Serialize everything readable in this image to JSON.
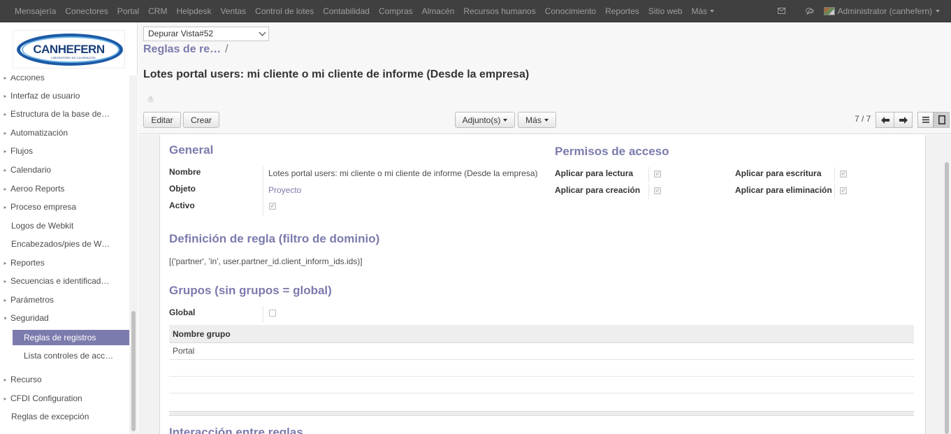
{
  "topbar": {
    "menu": [
      "Mensajería",
      "Conectores",
      "Portal",
      "CRM",
      "Helpdesk",
      "Ventas",
      "Control de lotes",
      "Contabilidad",
      "Compras",
      "Almacén",
      "Recursos humanos",
      "Conocimiento",
      "Reportes",
      "Sitio web",
      "Más"
    ],
    "user": "Administrator (canhefern)",
    "icons": [
      "mail-icon",
      "chat-icon"
    ]
  },
  "sidebar": {
    "logo_text": "CANHEFERN",
    "logo_sub": "LABORATORIO DE CALIBRACIÓN",
    "items": [
      {
        "label": "Acciones",
        "arrow": true
      },
      {
        "label": "Interfaz de usuario",
        "arrow": true
      },
      {
        "label": "Estructura de la base de…",
        "arrow": true
      },
      {
        "label": "Automatización",
        "arrow": true
      },
      {
        "label": "Flujos",
        "arrow": true
      },
      {
        "label": "Calendario",
        "arrow": true
      },
      {
        "label": "Aeroo Reports",
        "arrow": true
      },
      {
        "label": "Proceso empresa",
        "arrow": true
      },
      {
        "label": "Logos de Webkit",
        "arrow": false
      },
      {
        "label": "Encabezados/pies de W…",
        "arrow": false
      },
      {
        "label": "Reportes",
        "arrow": true
      },
      {
        "label": "Secuencias e identificad…",
        "arrow": true
      },
      {
        "label": "Parámetros",
        "arrow": true
      },
      {
        "label": "Seguridad",
        "arrow": true,
        "expanded": true
      },
      {
        "label": "Reglas de registros",
        "sub": true,
        "active": true
      },
      {
        "label": "Lista controles de acc…",
        "sub": true
      },
      {
        "label": "Recurso",
        "arrow": true
      },
      {
        "label": "CFDI Configuration",
        "arrow": true
      },
      {
        "label": "Reglas de excepción",
        "arrow": false
      }
    ]
  },
  "control_panel": {
    "debug_select": "Depurar Vista#52",
    "breadcrumb": "Reglas de re…",
    "breadcrumb_sep": "/",
    "record_title": "Lotes portal users: mi cliente o mi cliente de informe (Desde la empresa)",
    "edit": "Editar",
    "create": "Crear",
    "attachments": "Adjunto(s)",
    "more": "Más",
    "pager": "7 / 7"
  },
  "form": {
    "general_title": "General",
    "name_label": "Nombre",
    "name_value": "Lotes portal users: mi cliente o mi cliente de informe (Desde la empresa)",
    "object_label": "Objeto",
    "object_value": "Proyecto",
    "active_label": "Activo",
    "active": true,
    "access_title": "Permisos de acceso",
    "perm_read": "Aplicar para lectura",
    "perm_write": "Aplicar para escritura",
    "perm_create": "Aplicar para creación",
    "perm_delete": "Aplicar para eliminación",
    "rule_title": "Definición de regla (filtro de dominio)",
    "domain": "[('partner', 'in', user.partner_id.client_inform_ids.ids)]",
    "groups_title": "Grupos (sin grupos = global)",
    "global_label": "Global",
    "global": false,
    "groups_col": "Nombre grupo",
    "groups": [
      "Portal"
    ],
    "next_section": "Interacción entre reglas"
  }
}
